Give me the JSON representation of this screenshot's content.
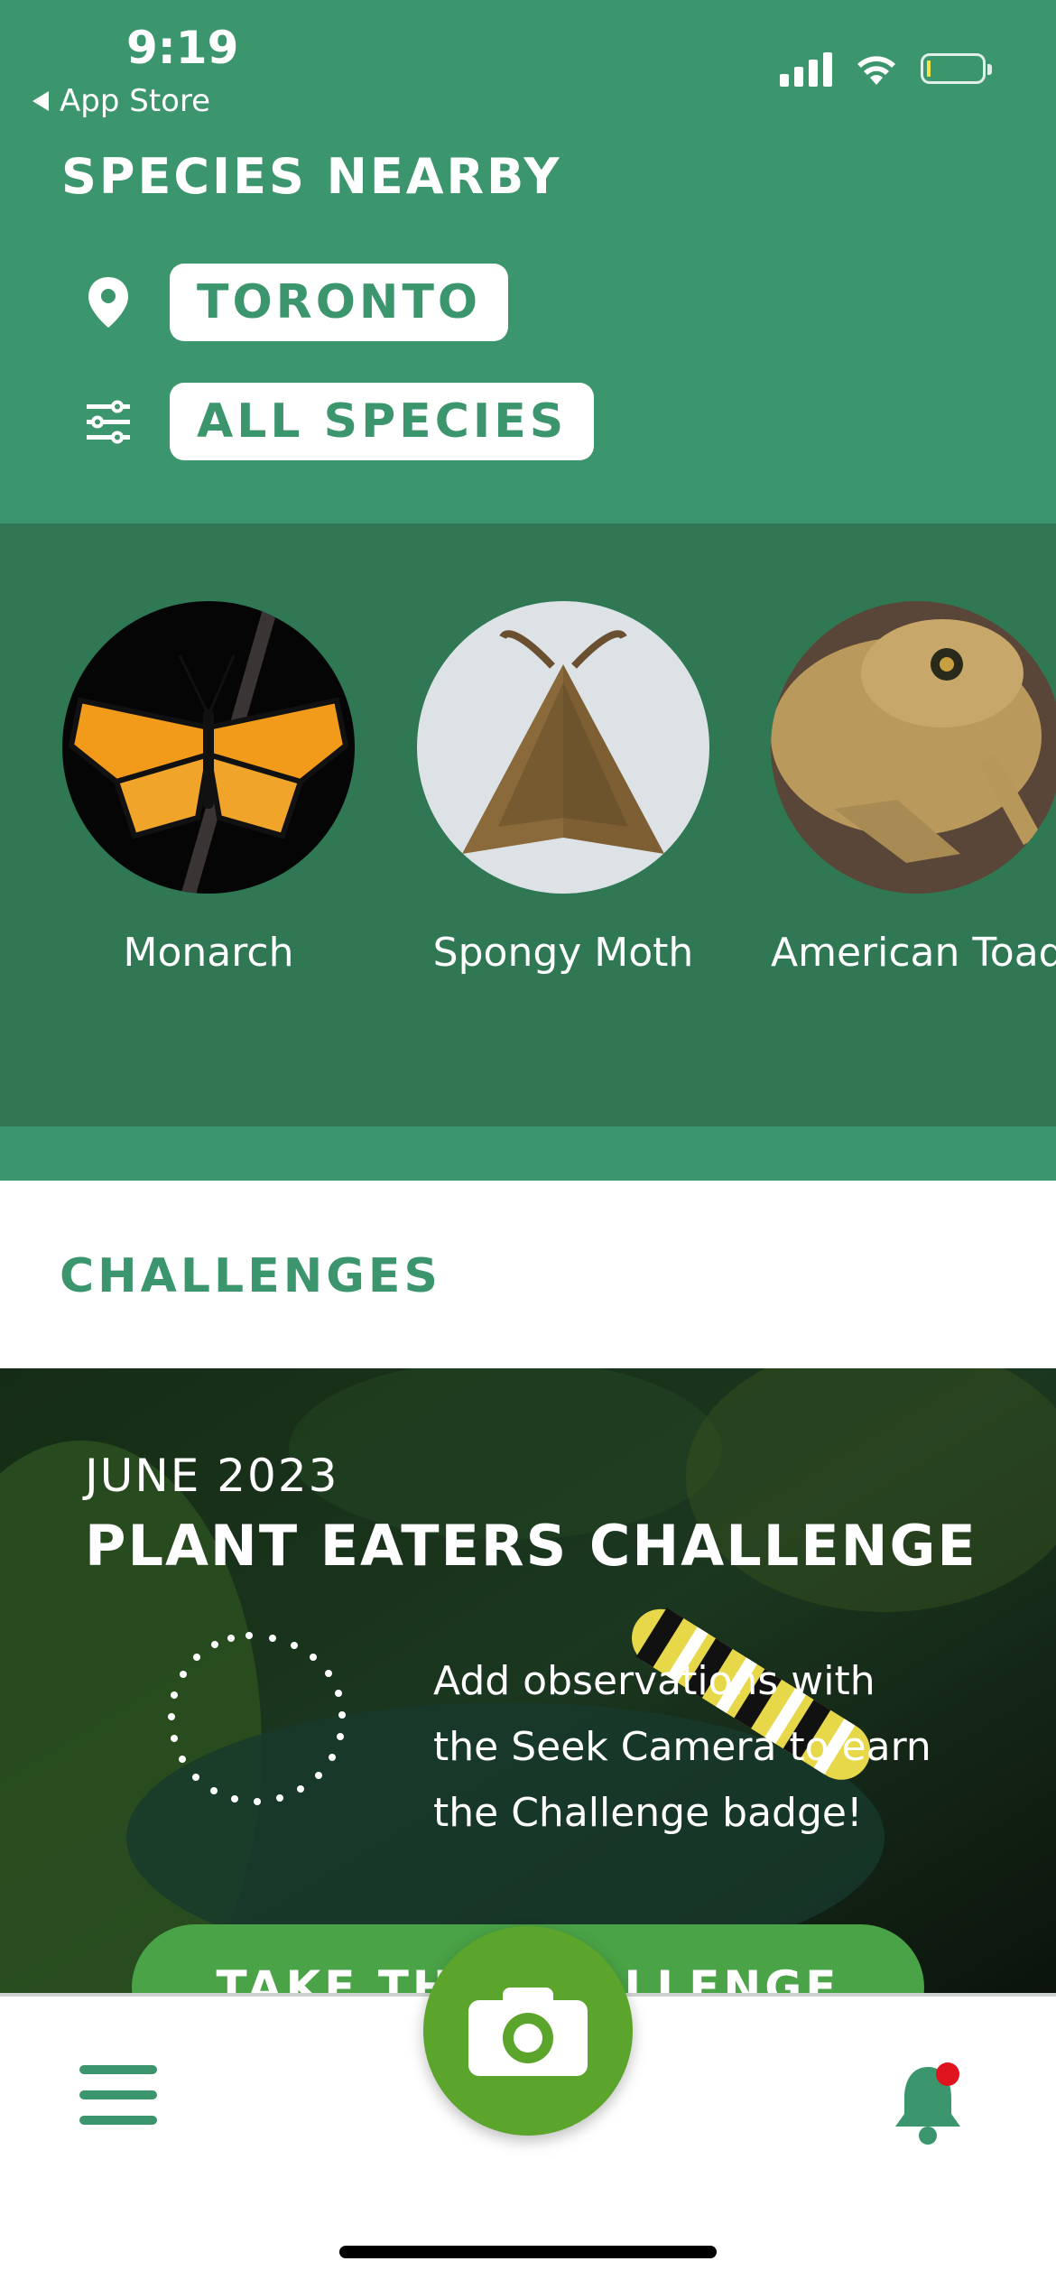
{
  "status_bar": {
    "time": "9:19",
    "back_label": "App Store"
  },
  "header": {
    "title": "SPECIES NEARBY",
    "location_label": "TORONTO",
    "filter_label": "ALL SPECIES"
  },
  "species": [
    {
      "name": "Monarch"
    },
    {
      "name": "Spongy Moth"
    },
    {
      "name": "American Toad"
    }
  ],
  "challenges": {
    "section_title": "CHALLENGES",
    "date": "JUNE 2023",
    "name": "PLANT EATERS CHALLENGE",
    "description": "Add observations with the Seek Camera to earn the Challenge badge!",
    "button_label": "TAKE THE CHALLENGE"
  },
  "colors": {
    "brand_green": "#3b956d",
    "dark_green": "#2f7853",
    "camera_green": "#5ca52c",
    "notification_dot": "#e0141e"
  }
}
